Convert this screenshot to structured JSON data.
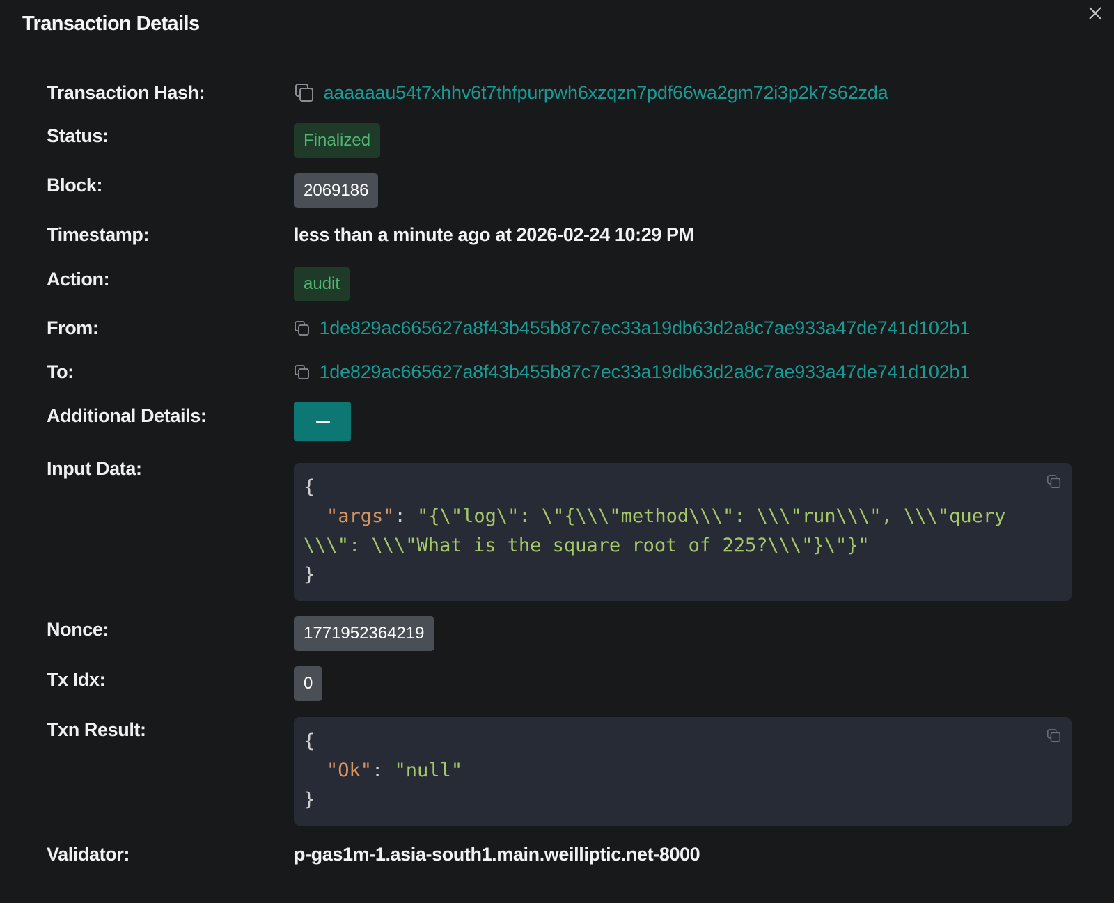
{
  "header": {
    "title": "Transaction Details"
  },
  "fields": {
    "hash": {
      "label": "Transaction Hash:",
      "value": "aaaaaau54t7xhhv6t7thfpurpwh6xzqzn7pdf66wa2gm72i3p2k7s62zda"
    },
    "status": {
      "label": "Status:",
      "value": "Finalized"
    },
    "block": {
      "label": "Block:",
      "value": "2069186"
    },
    "timestamp": {
      "label": "Timestamp:",
      "value": "less than a minute ago at 2026-02-24 10:29 PM"
    },
    "action": {
      "label": "Action:",
      "value": "audit"
    },
    "from": {
      "label": "From:",
      "value": "1de829ac665627a8f43b455b87c7ec33a19db63d2a8c7ae933a47de741d102b1"
    },
    "to": {
      "label": "To:",
      "value": "1de829ac665627a8f43b455b87c7ec33a19db63d2a8c7ae933a47de741d102b1"
    },
    "additional": {
      "label": "Additional Details:"
    },
    "input": {
      "label": "Input Data:",
      "open": "{",
      "key": "\"args\"",
      "sep": ": ",
      "val_line1": "\"{\\\"log\\\": \\\"{\\\\\\\"method\\\\\\\": \\\\\\\"run\\\\\\\", \\\\\\\"query",
      "val_line2": "\\\\\\\": \\\\\\\"What is the square root of 225?\\\\\\\"}\\\"}\"",
      "close": "}"
    },
    "nonce": {
      "label": "Nonce:",
      "value": "1771952364219"
    },
    "txidx": {
      "label": "Tx Idx:",
      "value": "0"
    },
    "result": {
      "label": "Txn Result:",
      "open": "{",
      "key": "\"Ok\"",
      "sep": ": ",
      "val": "\"null\"",
      "close": "}"
    },
    "validator": {
      "label": "Validator:",
      "value": "p-gas1m-1.asia-south1.main.weilliptic.net-8000"
    }
  },
  "colors": {
    "background": "#17191b",
    "link": "#1a9a95",
    "status_bg": "#1f3a29",
    "status_text": "#4fb774",
    "toggle_bg": "#0d7873",
    "code_bg": "#272b35"
  },
  "icons": {
    "close": "close-icon",
    "copy": "copy-icon",
    "collapse": "minus-icon"
  }
}
